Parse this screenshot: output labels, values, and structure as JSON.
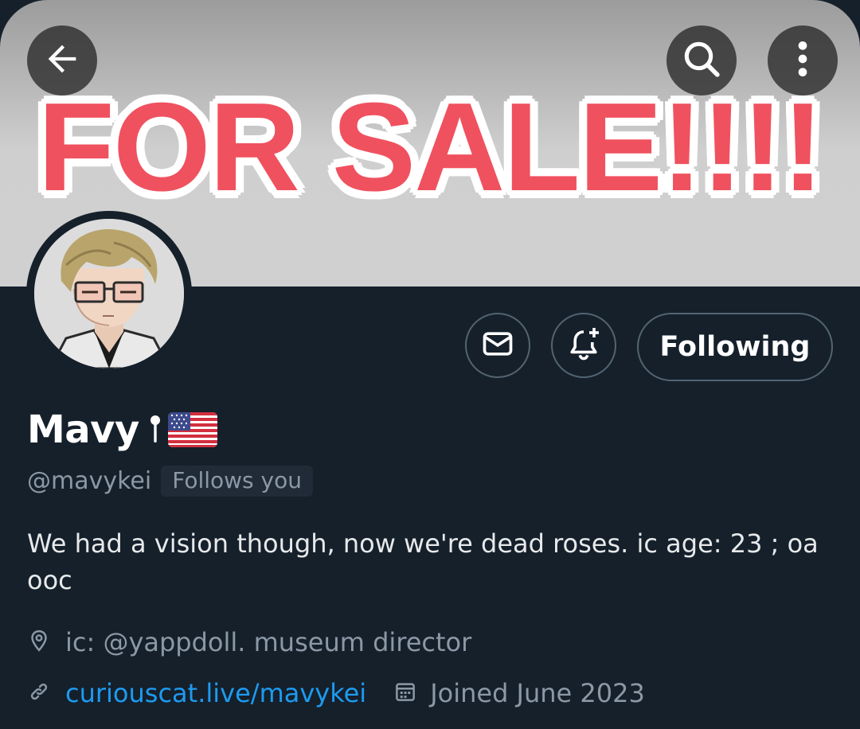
{
  "banner": {
    "text": "FOR SALE!!!!"
  },
  "header": {
    "back_icon": "arrow-left-icon",
    "search_icon": "search-icon",
    "more_icon": "more-vertical-icon"
  },
  "actions": {
    "message_icon": "envelope-icon",
    "notify_icon": "bell-plus-icon",
    "follow_label": "Following"
  },
  "profile": {
    "name": "Mavy",
    "handle": "@mavykei",
    "follows_you": "Follows you",
    "bio": "We had a vision though, now we're dead roses.  ic age: 23 ; oa ooc",
    "location": "ic: @yappdoll. museum director",
    "link": "curiouscat.live/mavykei",
    "joined": "Joined June 2023"
  },
  "colors": {
    "background": "#15202b",
    "banner_text": "#f0515f",
    "link": "#1d9bf0",
    "muted": "#8b98a5"
  }
}
